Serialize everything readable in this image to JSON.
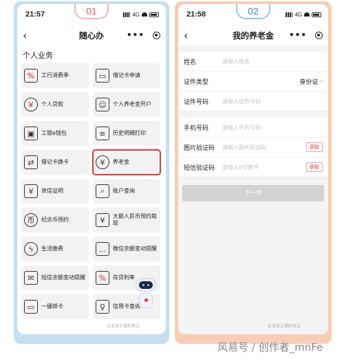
{
  "left": {
    "step": "01",
    "status": {
      "time": "21:57",
      "network": "4G"
    },
    "nav": {
      "back": "‹",
      "title": "随心办",
      "more": "•••"
    },
    "section_title": "个人业务",
    "tiles": [
      {
        "label": "工行消费季",
        "icon": "%",
        "icon_name": "percent-card-icon"
      },
      {
        "label": "借记卡申请",
        "icon": "▭",
        "icon_name": "debit-card-icon"
      },
      {
        "label": "个人贷款",
        "icon": "¥",
        "icon_name": "loan-icon"
      },
      {
        "label": "个人养老金开户",
        "icon": "☺",
        "icon_name": "pension-account-icon"
      },
      {
        "label": "工银e钱包",
        "icon": "▣",
        "icon_name": "wallet-icon"
      },
      {
        "label": "历史明细打印",
        "icon": "≡",
        "icon_name": "print-icon"
      },
      {
        "label": "借记卡换卡",
        "icon": "⇄",
        "icon_name": "card-swap-icon"
      },
      {
        "label": "养老金",
        "icon": "¥",
        "icon_name": "pension-icon"
      },
      {
        "label": "资信证明",
        "icon": "¥",
        "icon_name": "credit-certificate-icon"
      },
      {
        "label": "账户查询",
        "icon": "⌕",
        "icon_name": "account-query-icon"
      },
      {
        "label": "纪念币预约",
        "icon": "币",
        "icon_name": "coin-icon"
      },
      {
        "label": "大额人民币预约取现",
        "icon": "¥",
        "icon_name": "cash-withdraw-icon"
      },
      {
        "label": "生活缴费",
        "icon": "ϟ",
        "icon_name": "utility-icon"
      },
      {
        "label": "微信余额变动提醒",
        "icon": "…",
        "icon_name": "wechat-notify-icon"
      },
      {
        "label": "短信余额变动提醒",
        "icon": "✉",
        "icon_name": "sms-notify-icon"
      },
      {
        "label": "存贷利率",
        "icon": "%",
        "icon_name": "rate-icon"
      },
      {
        "label": "一键绑卡",
        "icon": "▭",
        "icon_name": "bind-card-icon"
      },
      {
        "label": "信用卡查询",
        "icon": "♀",
        "icon_name": "credit-card-query-icon"
      }
    ],
    "highlighted_index": 7,
    "watermark": "企业员工福利关注"
  },
  "right": {
    "step": "02",
    "status": {
      "time": "21:58",
      "network": "4G"
    },
    "nav": {
      "back": "‹",
      "title": "我的养老金",
      "more": "•••"
    },
    "form": {
      "name": {
        "label": "姓名",
        "placeholder": "请输入姓名"
      },
      "id_type": {
        "label": "证件类型",
        "value": "身份证"
      },
      "id_number": {
        "label": "证件号码",
        "placeholder": "请输入证件号码"
      },
      "phone": {
        "label": "手机号码",
        "placeholder": "请输入手机号码"
      },
      "image_code": {
        "label": "图片验证码",
        "placeholder": "请输入图片验证码",
        "button": "获取"
      },
      "sms_code": {
        "label": "短信验证码",
        "placeholder": "请输入6位数字",
        "button": "获取"
      }
    },
    "next_button": "下一步",
    "watermark": "企业员工福利关注"
  },
  "credit": "风易号 / 创作者_mnFe",
  "colors": {
    "left_frame": "#c4def2",
    "right_frame": "#f8cdb6",
    "highlight": "#d93a3a",
    "step1": "#e05a5a",
    "step2": "#3a86d6"
  }
}
